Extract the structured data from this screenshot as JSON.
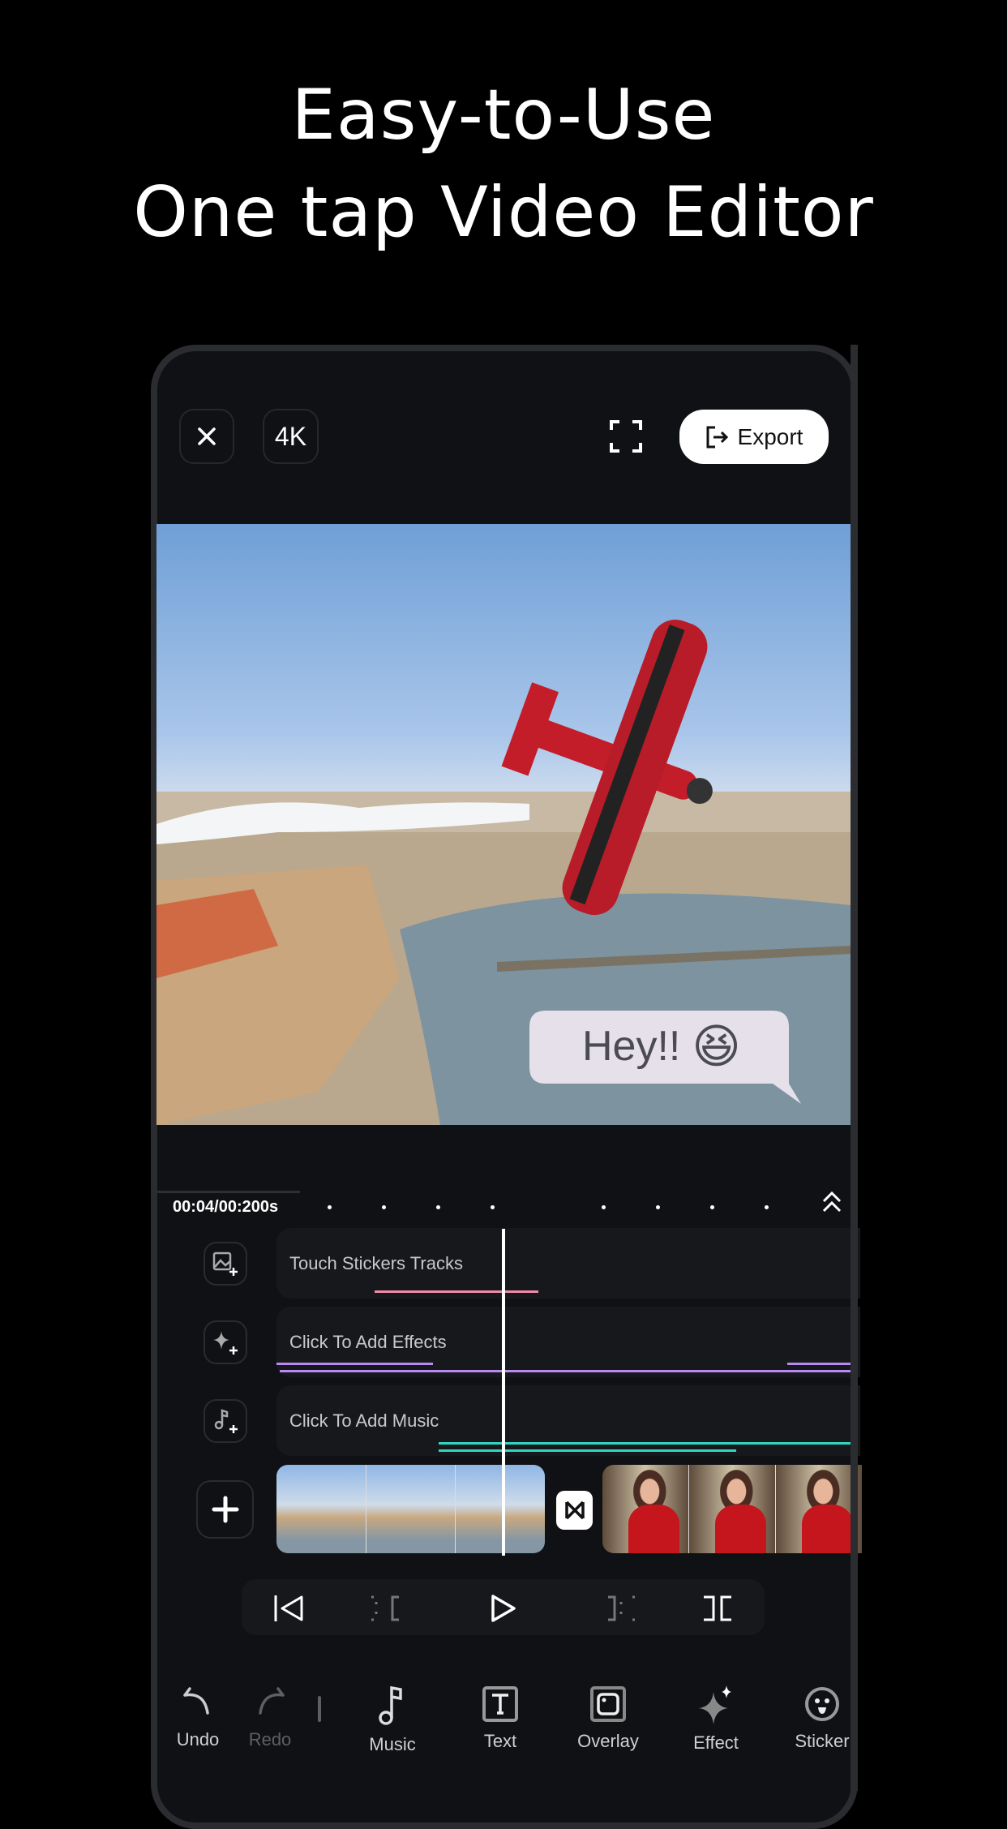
{
  "headline": {
    "line1": "Easy-to-Use",
    "line2": "One tap Video Editor"
  },
  "topbar": {
    "close_icon": "close-icon",
    "resolution": "4K",
    "fullscreen_icon": "fullscreen-icon",
    "export_label": "Export"
  },
  "preview": {
    "bubble_text": "Hey!!",
    "bubble_emoji": "😆"
  },
  "timeline": {
    "time": "00:04/00:200s",
    "tracks": [
      {
        "label": "Touch Stickers Tracks",
        "icon": "sticker-add-icon"
      },
      {
        "label": "Click To Add Effects",
        "icon": "effect-add-icon"
      },
      {
        "label": "Click To Add Music",
        "icon": "music-add-icon"
      }
    ],
    "colors": {
      "sticker": "#f08aa6",
      "effect": "#b88af0",
      "music": "#2fd6c0"
    }
  },
  "toolbar": {
    "items": [
      {
        "label": "Undo"
      },
      {
        "label": "Redo"
      },
      {
        "label": "Music"
      },
      {
        "label": "Text"
      },
      {
        "label": "Overlay"
      },
      {
        "label": "Effect"
      },
      {
        "label": "Sticker"
      }
    ]
  }
}
